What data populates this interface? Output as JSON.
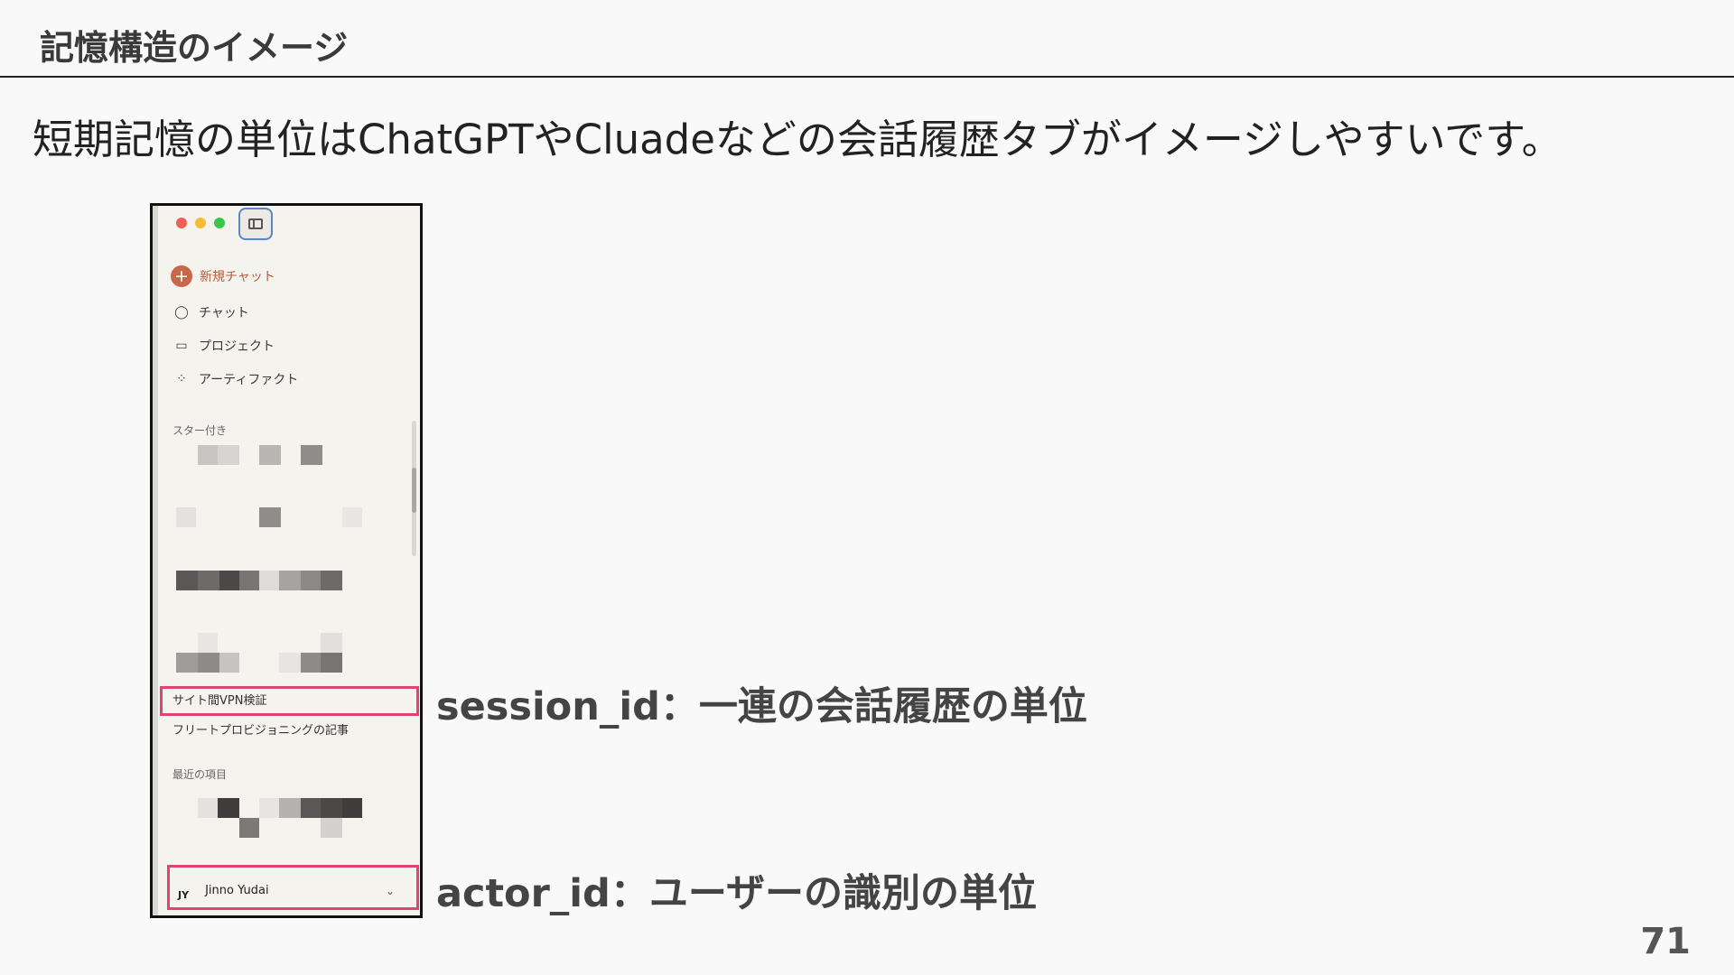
{
  "slide": {
    "title": "記憶構造のイメージ",
    "body": "短期記憶の単位はChatGPTやCluadeなどの会話履歴タブがイメージしやすいです。",
    "page_number": "71"
  },
  "app": {
    "new_chat_label": "新規チャット",
    "nav": [
      {
        "label": "チャット",
        "icon": "chat-icon"
      },
      {
        "label": "プロジェクト",
        "icon": "project-icon"
      },
      {
        "label": "アーティファクト",
        "icon": "artifact-icon"
      }
    ],
    "starred_label": "スター付き",
    "conversations": [
      {
        "label": "サイト間VPN検証",
        "highlighted": true
      },
      {
        "label": "フリートプロビジョニングの記事",
        "highlighted": false
      }
    ],
    "recent_label": "最近の項目",
    "user": {
      "initials": "JY",
      "name": "Jinno Yudai"
    }
  },
  "annotations": {
    "session": "session_id：一連の会話履歴の単位",
    "actor": "actor_id：ユーザーの識別の単位"
  },
  "colors": {
    "accent": "#c9674a",
    "highlight": "#e0456e"
  }
}
